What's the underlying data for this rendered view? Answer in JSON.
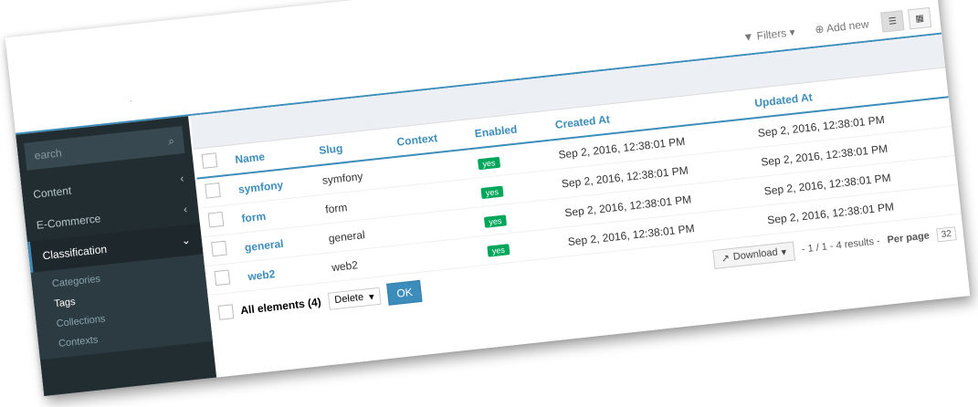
{
  "toolbar": {
    "filters_label": "Filters",
    "add_new_label": "Add new"
  },
  "sidebar": {
    "search_placeholder": "earch",
    "items": [
      {
        "label": "Content",
        "chevron": "‹"
      },
      {
        "label": "E-Commerce",
        "chevron": "‹"
      },
      {
        "label": "Classification",
        "chevron": "⌄"
      }
    ],
    "subitems": [
      "Categories",
      "Tags",
      "Collections",
      "Contexts"
    ]
  },
  "table": {
    "headers": [
      "Name",
      "Slug",
      "Context",
      "Enabled",
      "Created At",
      "Updated At"
    ],
    "rows": [
      {
        "name": "symfony",
        "slug": "symfony",
        "context": "",
        "enabled": "yes",
        "created": "Sep 2, 2016, 12:38:01 PM",
        "updated": "Sep 2, 2016, 12:38:01 PM"
      },
      {
        "name": "form",
        "slug": "form",
        "context": "",
        "enabled": "yes",
        "created": "Sep 2, 2016, 12:38:01 PM",
        "updated": "Sep 2, 2016, 12:38:01 PM"
      },
      {
        "name": "general",
        "slug": "general",
        "context": "",
        "enabled": "yes",
        "created": "Sep 2, 2016, 12:38:01 PM",
        "updated": "Sep 2, 2016, 12:38:01 PM"
      },
      {
        "name": "web2",
        "slug": "web2",
        "context": "",
        "enabled": "yes",
        "created": "Sep 2, 2016, 12:38:01 PM",
        "updated": "Sep 2, 2016, 12:38:01 PM"
      }
    ],
    "extra_updated": "Sep 2, 2016, 12:38:01 PM"
  },
  "footer": {
    "all_elements_label": "All elements (4)",
    "action_value": "Delete",
    "ok_label": "OK",
    "download_label": "Download",
    "pagination": "- 1 / 1 - 4 results -",
    "per_page_label": "Per page",
    "per_page_value": "32"
  },
  "colors": {
    "accent": "#3c8dbc",
    "sidebar": "#222d32",
    "badge": "#00a65a"
  }
}
